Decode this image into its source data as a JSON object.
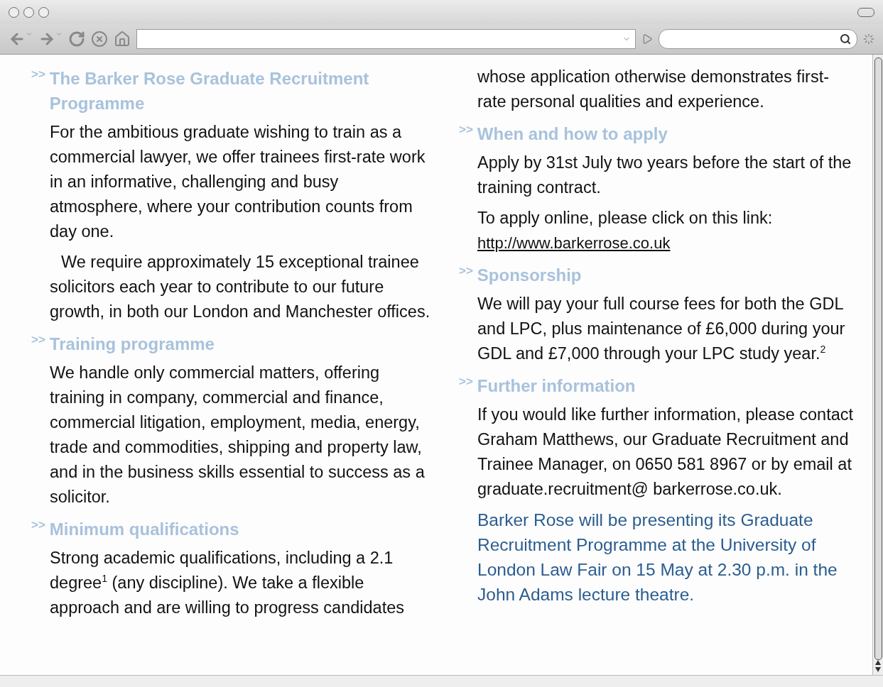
{
  "columns": [
    {
      "blocks": [
        {
          "kind": "heading",
          "marker": ">>",
          "text": "The Barker Rose Graduate Recruitment Programme"
        },
        {
          "kind": "paragraph",
          "text": "For the ambitious graduate wishing to train as a commercial lawyer, we offer trainees first-rate work in an informative, challenging and busy atmosphere, where your contribution counts from day one."
        },
        {
          "kind": "indented",
          "text": "We require approximately 15 exceptional trainee solicitors each year to contribute to our future growth, in both our London and Manchester offices."
        },
        {
          "kind": "heading",
          "marker": ">>",
          "text": "Training programme"
        },
        {
          "kind": "paragraph",
          "text": "We handle only commercial matters, offering training in company, commercial and finance, commercial litigation, employment, media, energy, trade and commodities, shipping and property law, and in the business skills essential to success as a solicitor."
        },
        {
          "kind": "heading",
          "marker": ">>",
          "text": "Minimum qualifications"
        },
        {
          "kind": "paragraph",
          "text": "Strong academic qualifications, including a 2.1 degree$^{1}$ (any discipline). We take a flexible approach and are willing to progress candidates"
        }
      ]
    },
    {
      "blocks": [
        {
          "kind": "paragraph",
          "text": "whose application otherwise demonstrates first-rate personal qualities and experience."
        },
        {
          "kind": "heading",
          "marker": ">>",
          "text": "When and how to apply"
        },
        {
          "kind": "paragraph",
          "text": "Apply by 31st July two years before the start of the training contract."
        },
        {
          "kind": "paragraph",
          "text": "To apply online, please click on this link:"
        },
        {
          "kind": "link",
          "text": "http://www.barkerrose.co.uk"
        },
        {
          "kind": "heading",
          "marker": ">>",
          "text": "Sponsorship"
        },
        {
          "kind": "paragraph",
          "text": "We will pay your full course fees for both the GDL and LPC, plus maintenance of £6,000 during your GDL and £7,000 through your LPC study year.$^{2}$"
        },
        {
          "kind": "heading",
          "marker": ">>",
          "text": "Further information"
        },
        {
          "kind": "paragraph",
          "text": "If you would like further information, please contact Graham Matthews, our Graduate Recruitment and Trainee Manager, on 0650 581 8967 or by email at graduate.recruitment@ barkerrose.co.uk."
        },
        {
          "kind": "notice",
          "text": "Barker Rose will be presenting its Graduate Recruitment Programme at the University of London Law Fair on 15 May at 2.30 p.m. in the John Adams lecture theatre."
        }
      ]
    }
  ]
}
